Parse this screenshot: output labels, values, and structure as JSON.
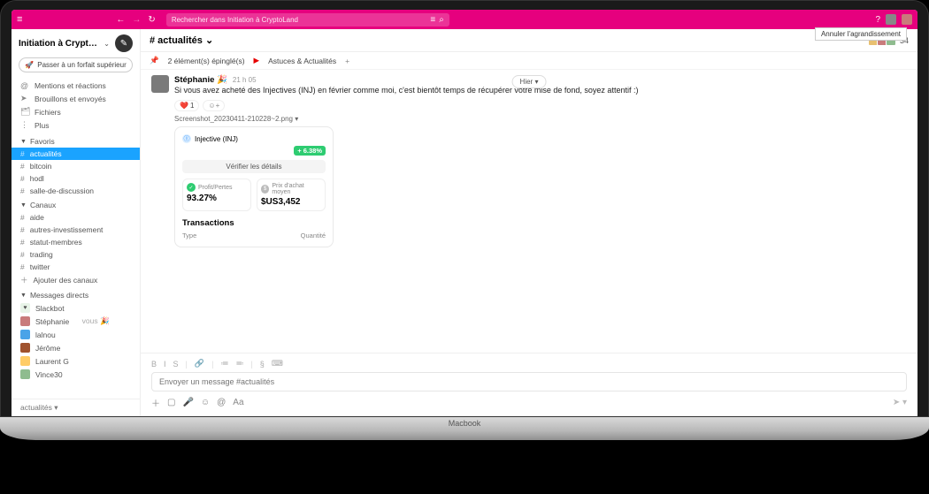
{
  "laptop": {
    "brand": "Macbook"
  },
  "topbar": {
    "search_placeholder": "Rechercher dans Initiation à CryptoLand",
    "tooltip": "Annuler l'agrandissement"
  },
  "workspace": {
    "name": "Initiation à Crypt…",
    "upgrade_label": "Passer à un forfait supérieur"
  },
  "sidebar": {
    "nav": [
      {
        "icon": "@",
        "label": "Mentions et réactions"
      },
      {
        "icon": "➤",
        "label": "Brouillons et envoyés"
      },
      {
        "icon": "🗂",
        "label": "Fichiers"
      },
      {
        "icon": "⋮",
        "label": "Plus"
      }
    ],
    "favorites_label": "Favoris",
    "favorites": [
      {
        "label": "actualités",
        "active": true
      },
      {
        "label": "bitcoin"
      },
      {
        "label": "hodl"
      },
      {
        "label": "salle-de-discussion"
      }
    ],
    "channels_label": "Canaux",
    "channels": [
      {
        "label": "aide"
      },
      {
        "label": "autres-investissement"
      },
      {
        "label": "statut-membres"
      },
      {
        "label": "trading"
      },
      {
        "label": "twitter"
      }
    ],
    "add_channels": "Ajouter des canaux",
    "dms_label": "Messages directs",
    "dms": [
      {
        "name": "Slackbot",
        "color": "#e8f4e8"
      },
      {
        "name": "Stéphanie",
        "suffix": "vous 🎉",
        "color": "#c97b7b"
      },
      {
        "name": "lalnou",
        "color": "#4aa3e8"
      },
      {
        "name": "Jérôme",
        "color": "#a0522d"
      },
      {
        "name": "Laurent G",
        "color": "#ffcc66"
      },
      {
        "name": "Vince30",
        "color": "#8fbc8f"
      }
    ],
    "footer": "actualités ▾"
  },
  "channel_header": {
    "name": "# actualités",
    "chevron": "⌄",
    "member_count": "34"
  },
  "pins": {
    "count_label": "2 élément(s) épinglé(s)",
    "tab_label": "Astuces & Actualités"
  },
  "date_divider": "Hier ▾",
  "message": {
    "author": "Stéphanie 🎉",
    "time": "21 h 05",
    "text": "Si vous avez acheté des Injectives (INJ) en février comme moi, c'est bientôt temps de récupérer votre mise de fond, soyez attentif :)"
  },
  "reactions": {
    "heart": "❤️",
    "heart_count": "1",
    "add": "☺+"
  },
  "attachment": {
    "filename": "Screenshot_20230411-210228~2.png ▾",
    "coin_name": "Injective (INJ)",
    "change_badge": "+ 6.38%",
    "verify_label": "Vérifier les détails",
    "stat1_label": "Profit/Pertes",
    "stat1_value": "93.27%",
    "stat2_label": "Prix d'achat moyen",
    "stat2_value": "$US3,452",
    "transactions_title": "Transactions",
    "col_type": "Type",
    "col_qty": "Quantité"
  },
  "composer": {
    "placeholder": "Envoyer un message #actualités",
    "format_buttons": [
      "B",
      "I",
      "S",
      "|",
      "🔗",
      "|",
      "≔",
      "≕",
      "|",
      "§",
      "⌨"
    ]
  }
}
